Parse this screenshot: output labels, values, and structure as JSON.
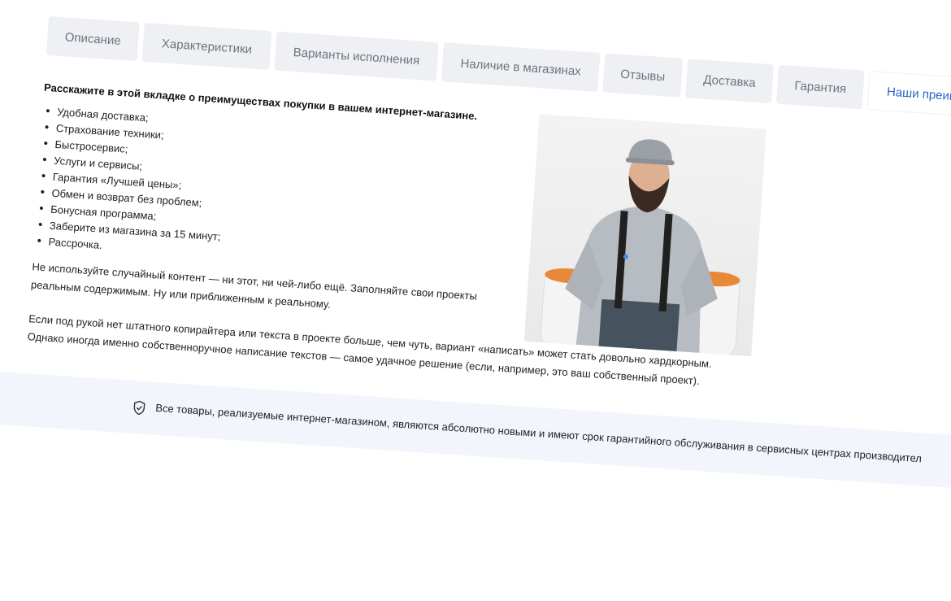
{
  "tabs": [
    {
      "label": "Описание"
    },
    {
      "label": "Характеристики"
    },
    {
      "label": "Варианты исполнения"
    },
    {
      "label": "Наличие в магазинах"
    },
    {
      "label": "Отзывы"
    },
    {
      "label": "Доставка"
    },
    {
      "label": "Гарантия"
    },
    {
      "label": "Наши преим",
      "active": true
    }
  ],
  "content": {
    "heading": "Расскажите в этой вкладке о преимуществах покупки в вашем интернет-магазине.",
    "benefits": [
      "Удобная доставка;",
      "Страхование техники;",
      "Быстросервис;",
      "Услуги и сервисы;",
      "Гарантия «Лучшей цены»;",
      "Обмен и возврат без проблем;",
      "Бонусная программа;",
      "Заберите из магазина за 15 минут;",
      "Рассрочка."
    ],
    "para1_line1": "Не используйте случайный контент — ни этот, ни чей-либо ещё. Заполняйте свои проекты",
    "para1_line2": "реальным содержимым. Ну или приближенным к реальному.",
    "para2_line1": "Если под рукой нет штатного копирайтера или текста в проекте больше, чем чуть, вариант «написать» может стать довольно хардкорным.",
    "para2_line2": "Однако иногда именно собственноручное написание текстов — самое удачное решение (если, например, это ваш собственный проект)."
  },
  "notice": {
    "icon": "shield-check-icon",
    "text": "Все товары, реализуемые интернет-магазином, являются абсолютно новыми и имеют срок гарантийного обслуживания в сервисных центрах производител"
  },
  "colors": {
    "tab_bg": "#eef0f3",
    "tab_text": "#6c7480",
    "active_tab_text": "#2a63c6",
    "notice_bg": "#f2f6fc"
  }
}
